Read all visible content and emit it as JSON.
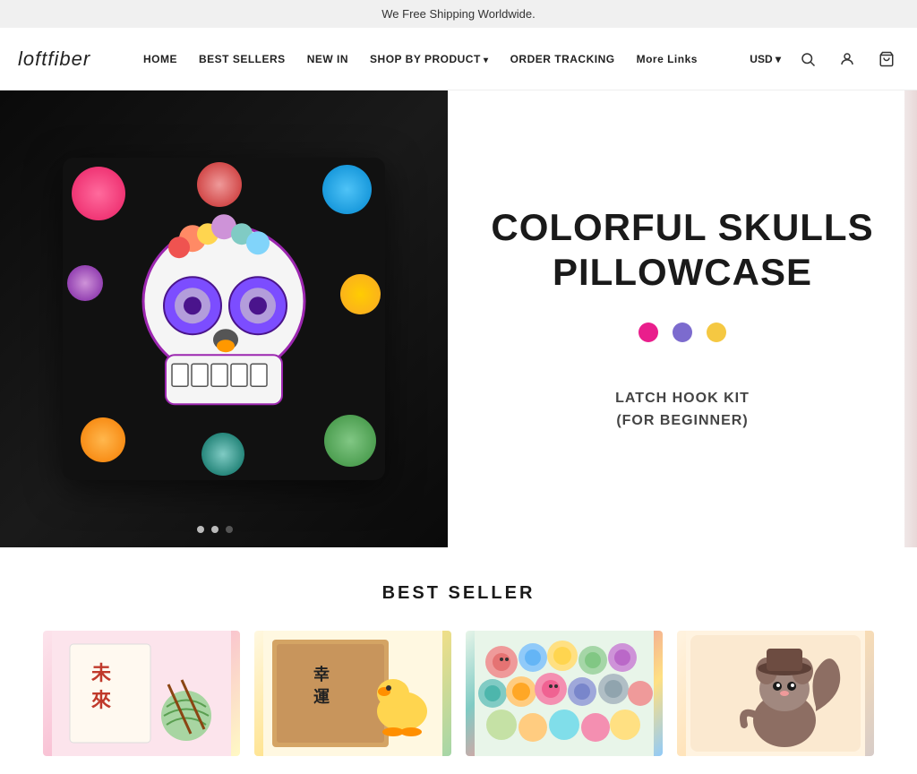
{
  "announcement": {
    "text": "We Free Shipping Worldwide."
  },
  "header": {
    "logo": "loftfiber",
    "nav": [
      {
        "label": "HOME",
        "dropdown": false
      },
      {
        "label": "BEST SELLERS",
        "dropdown": false
      },
      {
        "label": "NEW IN",
        "dropdown": false
      },
      {
        "label": "SHOP BY PRODUCT",
        "dropdown": true
      },
      {
        "label": "ORDER TRACKING",
        "dropdown": false
      },
      {
        "label": "More Links",
        "dropdown": false
      }
    ],
    "currency": "USD ▾"
  },
  "hero": {
    "title_line1": "COLORFUL SKULLS",
    "title_line2": "PILLOWCASE",
    "subtitle_line1": "LATCH HOOK KIT",
    "subtitle_line2": "(FOR BEGINNER)",
    "colors": [
      {
        "name": "pink",
        "hex": "#e91e8c"
      },
      {
        "name": "purple",
        "hex": "#7c6bce"
      },
      {
        "name": "yellow",
        "hex": "#f5c842"
      }
    ],
    "slide_count": 3,
    "active_slide": 2
  },
  "best_seller": {
    "title": "BEST SELLER",
    "products": [
      {
        "id": 1,
        "alt": "Japanese craft product"
      },
      {
        "id": 2,
        "alt": "Yellow duck craft"
      },
      {
        "id": 3,
        "alt": "Colorful plush toys"
      },
      {
        "id": 4,
        "alt": "Brown squirrel craft"
      }
    ]
  },
  "icons": {
    "search": "🔍",
    "user": "👤",
    "cart": "🛒"
  }
}
